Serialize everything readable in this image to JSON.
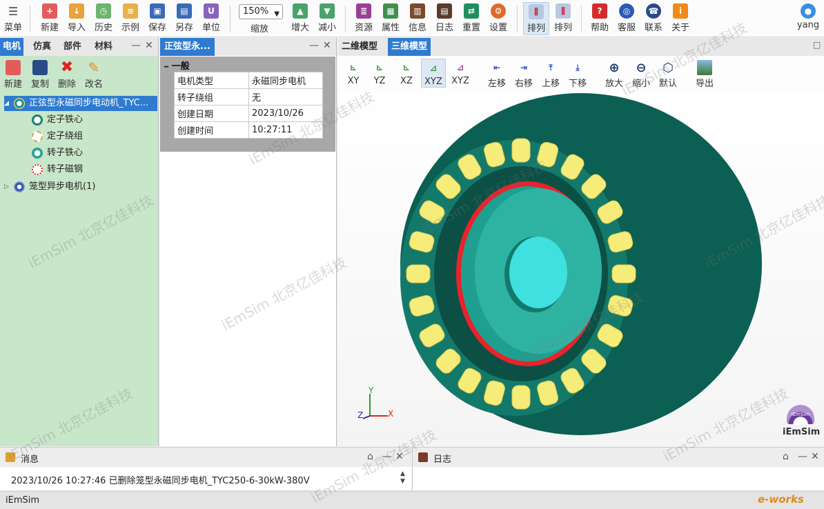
{
  "toolbar": {
    "menu": "菜单",
    "new": "新建",
    "import": "导入",
    "history": "历史",
    "example": "示例",
    "save": "保存",
    "save_as": "另存",
    "unit": "单位",
    "zoom_value": "150%",
    "zoom_label": "缩放",
    "zoom_in": "增大",
    "zoom_out": "减小",
    "resources": "资源",
    "properties": "属性",
    "info": "信息",
    "log": "日志",
    "reset": "重置",
    "settings": "设置",
    "arrange1": "排列",
    "arrange2": "排列",
    "help": "帮助",
    "service": "客服",
    "contact": "联系",
    "about": "关于",
    "user": "yang"
  },
  "left_panel": {
    "tabs": [
      "电机",
      "仿真",
      "部件",
      "材料"
    ],
    "actions": {
      "new": "新建",
      "copy": "复制",
      "delete": "删除",
      "rename": "改名"
    },
    "tree": {
      "root": "正弦型永磁同步电动机_TYC...",
      "children": [
        "定子铁心",
        "定子绕组",
        "转子铁心",
        "转子磁钢"
      ],
      "second": "笼型异步电机(1)"
    }
  },
  "mid_panel": {
    "tab": "正弦型永...",
    "group": "一般",
    "rows": [
      {
        "key": "电机类型",
        "value": "永磁同步电机"
      },
      {
        "key": "转子绕组",
        "value": "无"
      },
      {
        "key": "创建日期",
        "value": "2023/10/26"
      },
      {
        "key": "创建时间",
        "value": "10:27:11"
      }
    ]
  },
  "viewport": {
    "tabs": [
      "二维模型",
      "三维模型"
    ],
    "tools": {
      "xy": "XY",
      "yz": "YZ",
      "xz": "XZ",
      "xyz": "XYZ",
      "xyz2": "XYZ",
      "left": "左移",
      "right": "右移",
      "up": "上移",
      "down": "下移",
      "zoomin": "放大",
      "zoomout": "缩小",
      "default": "默认",
      "export": "导出"
    },
    "axes": {
      "x": "X",
      "y": "Y",
      "z": "Z"
    },
    "logo_text": "iEmSim",
    "logo_badge": "iEmSim"
  },
  "messages": {
    "title": "消息",
    "text": "2023/10/26 10:27:46  已删除笼型永磁同步电机_TYC250-6-30kW-380V"
  },
  "log": {
    "title": "日志"
  },
  "status": {
    "text": "iEmSim"
  },
  "watermark": "iEmSim 北京亿佳科技",
  "corner_logo": "e-works",
  "colors": {
    "accent": "#2e7bcf",
    "stator": "#0f6a5e",
    "coil": "#f6ec7a",
    "magnet": "#e8232b",
    "rotor": "#2eb3a2"
  }
}
